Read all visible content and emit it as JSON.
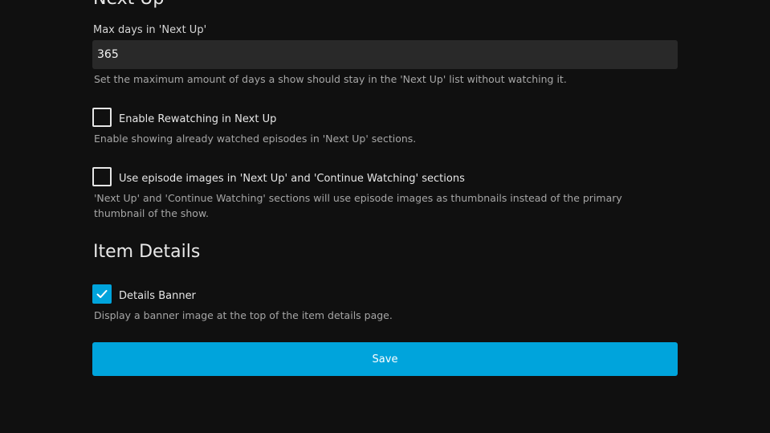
{
  "next_up": {
    "heading": "Next Up",
    "max_days": {
      "label": "Max days in 'Next Up'",
      "value": "365",
      "description": "Set the maximum amount of days a show should stay in the 'Next Up' list without watching it."
    },
    "rewatching": {
      "label": "Enable Rewatching in Next Up",
      "checked": false,
      "description": "Enable showing already watched episodes in 'Next Up' sections."
    },
    "episode_images": {
      "label": "Use episode images in 'Next Up' and 'Continue Watching' sections",
      "checked": false,
      "description": "'Next Up' and 'Continue Watching' sections will use episode images as thumbnails instead of the primary thumbnail of the show."
    }
  },
  "item_details": {
    "heading": "Item Details",
    "details_banner": {
      "label": "Details Banner",
      "checked": true,
      "description": "Display a banner image at the top of the item details page."
    }
  },
  "save_button": {
    "label": "Save"
  },
  "colors": {
    "background": "#101010",
    "accent": "#00a4dc",
    "input_background": "#292929",
    "description_text": "#a6a6a6"
  },
  "icons": {
    "checked": "checkmark-icon"
  }
}
